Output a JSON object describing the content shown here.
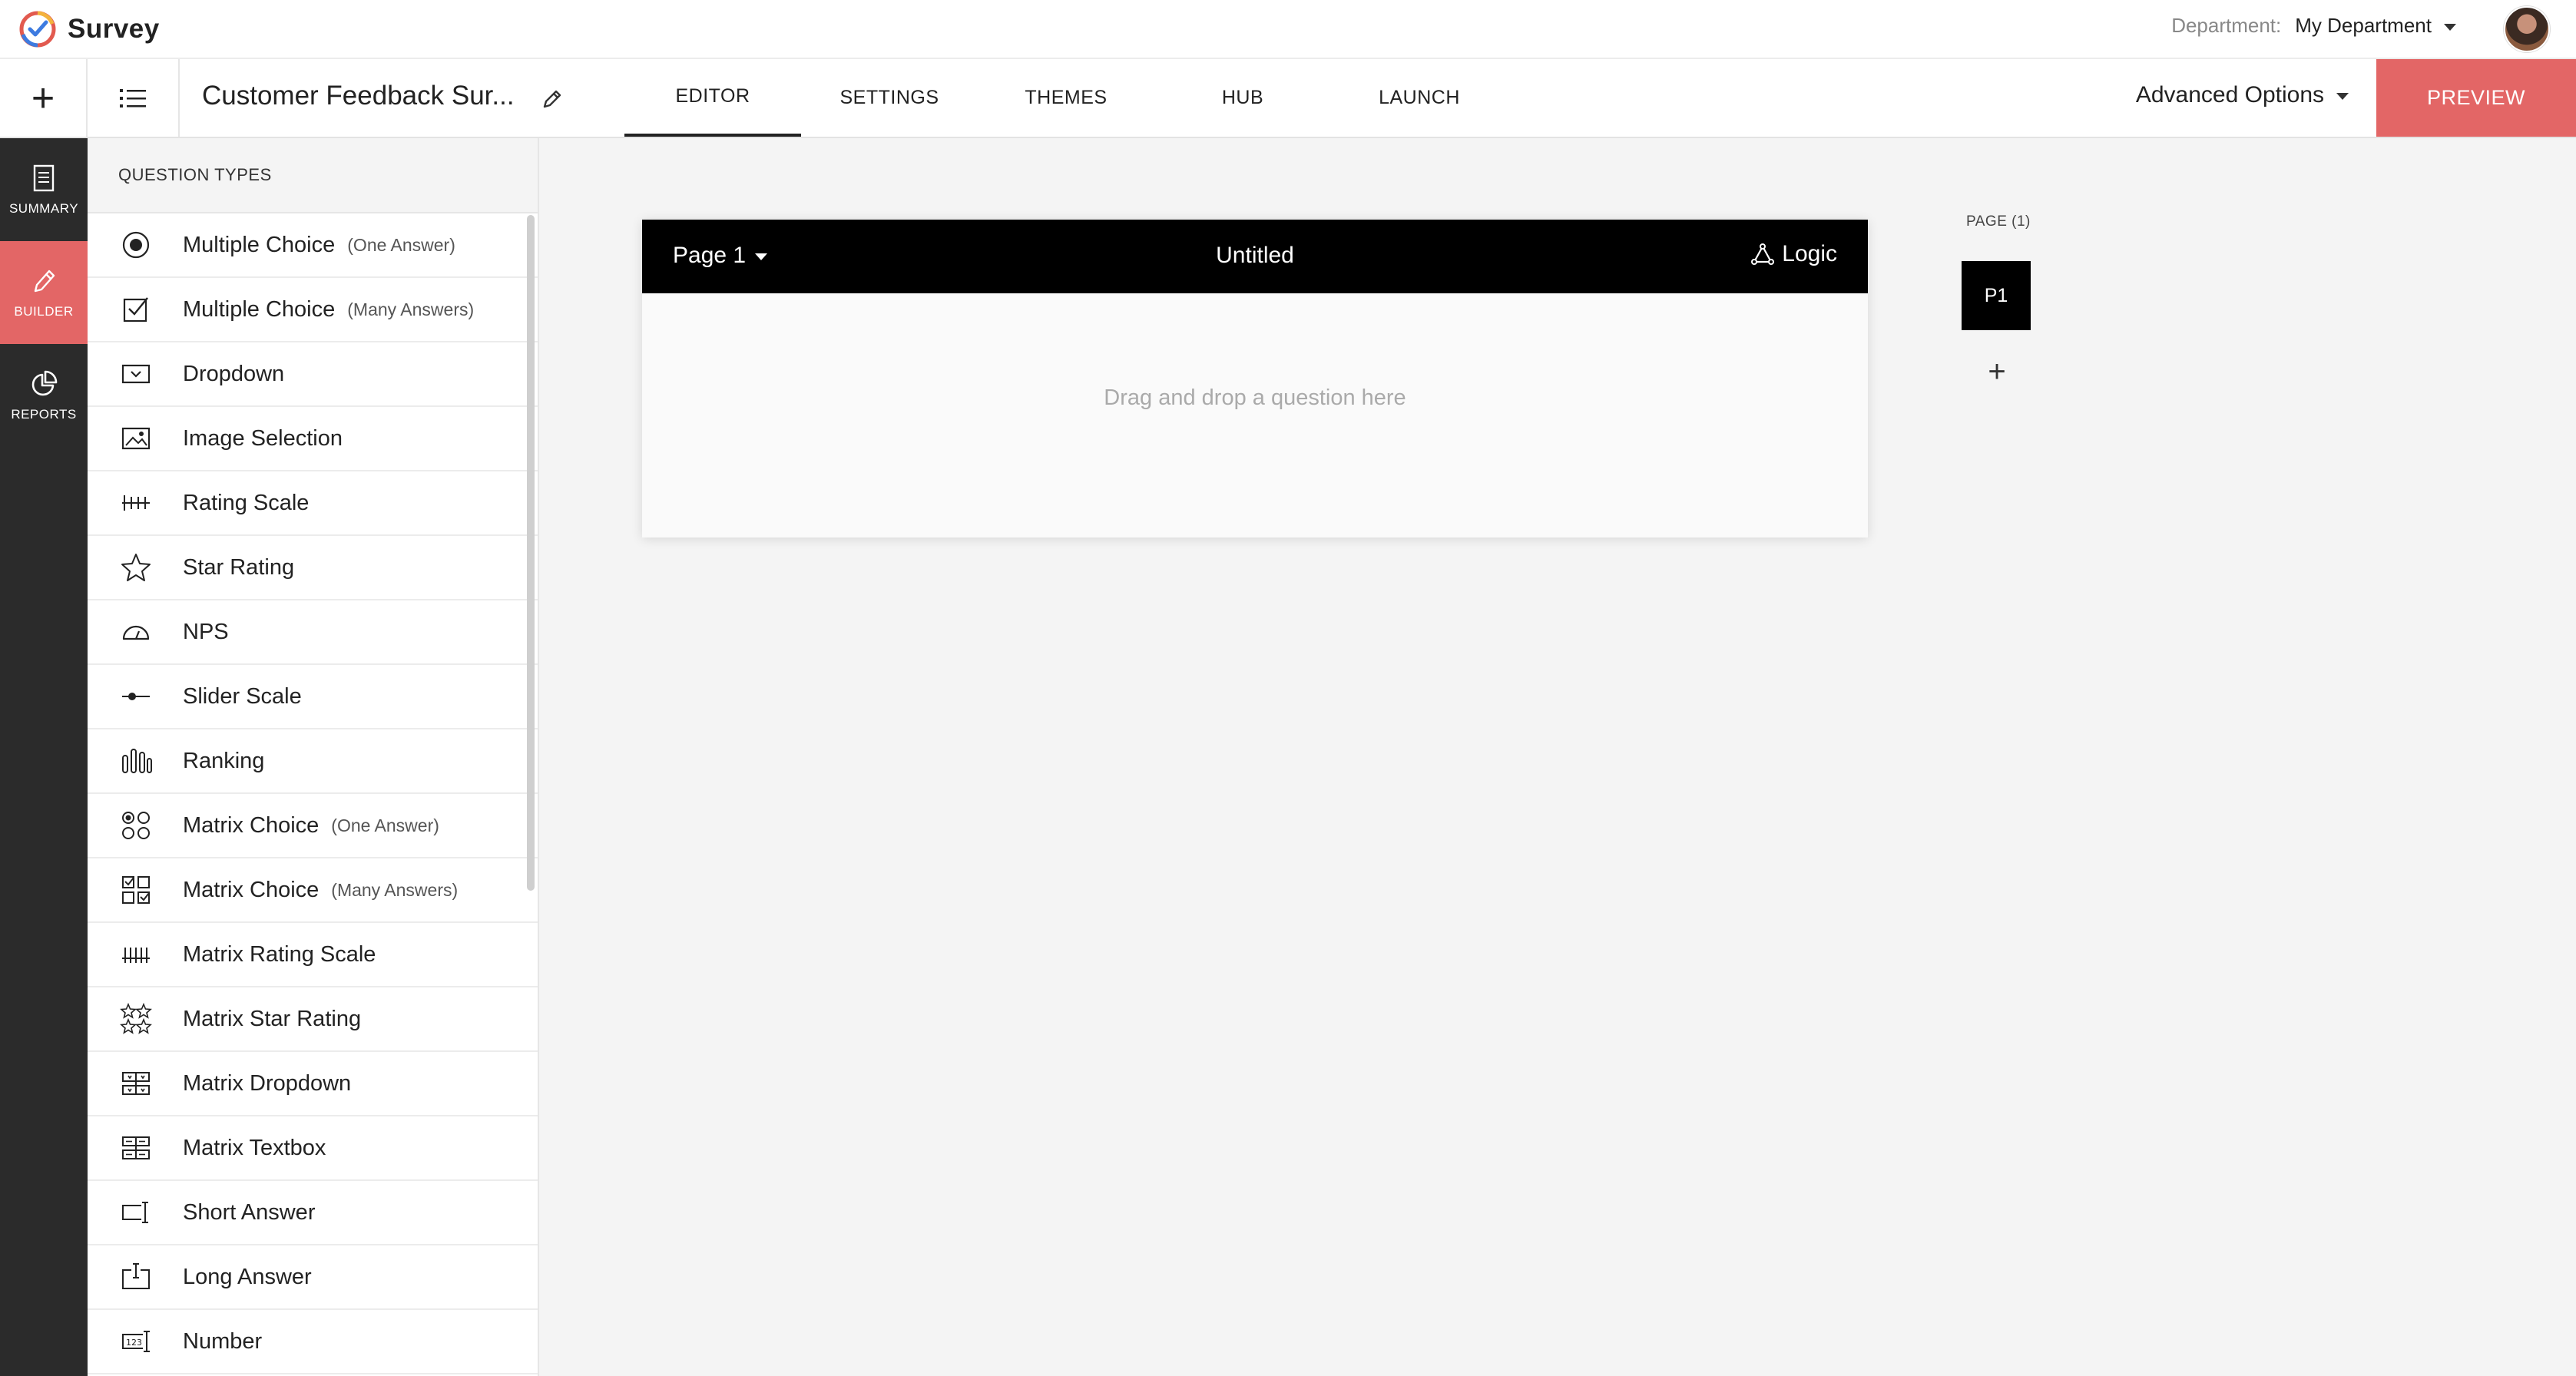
{
  "app": {
    "name": "Survey"
  },
  "header": {
    "department_label": "Department:",
    "department_value": "My Department"
  },
  "toolbar": {
    "add_label": "+",
    "survey_title": "Customer Feedback Sur...",
    "tabs": [
      {
        "label": "EDITOR",
        "active": true
      },
      {
        "label": "SETTINGS",
        "active": false
      },
      {
        "label": "THEMES",
        "active": false
      },
      {
        "label": "HUB",
        "active": false
      },
      {
        "label": "LAUNCH",
        "active": false
      }
    ],
    "advanced_options": "Advanced Options",
    "preview": "PREVIEW"
  },
  "rail": {
    "items": [
      {
        "label": "SUMMARY",
        "icon": "document-icon",
        "active": false
      },
      {
        "label": "BUILDER",
        "icon": "pencil-icon",
        "active": true
      },
      {
        "label": "REPORTS",
        "icon": "pie-chart-icon",
        "active": false
      }
    ]
  },
  "question_panel": {
    "header": "QUESTION TYPES",
    "items": [
      {
        "name": "Multiple Choice",
        "sub": "(One Answer)",
        "icon": "radio-icon"
      },
      {
        "name": "Multiple Choice",
        "sub": "(Many Answers)",
        "icon": "checkbox-icon"
      },
      {
        "name": "Dropdown",
        "sub": "",
        "icon": "dropdown-icon"
      },
      {
        "name": "Image Selection",
        "sub": "",
        "icon": "image-icon"
      },
      {
        "name": "Rating Scale",
        "sub": "",
        "icon": "rating-scale-icon"
      },
      {
        "name": "Star Rating",
        "sub": "",
        "icon": "star-icon"
      },
      {
        "name": "NPS",
        "sub": "",
        "icon": "gauge-icon"
      },
      {
        "name": "Slider Scale",
        "sub": "",
        "icon": "slider-icon"
      },
      {
        "name": "Ranking",
        "sub": "",
        "icon": "ranking-icon"
      },
      {
        "name": "Matrix Choice",
        "sub": "(One Answer)",
        "icon": "matrix-radio-icon"
      },
      {
        "name": "Matrix Choice",
        "sub": "(Many Answers)",
        "icon": "matrix-checkbox-icon"
      },
      {
        "name": "Matrix Rating Scale",
        "sub": "",
        "icon": "matrix-rating-icon"
      },
      {
        "name": "Matrix Star Rating",
        "sub": "",
        "icon": "matrix-star-icon"
      },
      {
        "name": "Matrix Dropdown",
        "sub": "",
        "icon": "matrix-dropdown-icon"
      },
      {
        "name": "Matrix Textbox",
        "sub": "",
        "icon": "matrix-textbox-icon"
      },
      {
        "name": "Short Answer",
        "sub": "",
        "icon": "short-answer-icon"
      },
      {
        "name": "Long Answer",
        "sub": "",
        "icon": "long-answer-icon"
      },
      {
        "name": "Number",
        "sub": "",
        "icon": "number-icon"
      }
    ]
  },
  "canvas": {
    "page_name": "Page 1",
    "page_title": "Untitled",
    "logic": "Logic",
    "drop_hint": "Drag and drop a question here"
  },
  "pages": {
    "label": "PAGE (1)",
    "items": [
      "P1"
    ],
    "add": "+"
  },
  "colors": {
    "accent": "#e36666",
    "rail": "#2b2b2b",
    "page_header": "#000000"
  }
}
